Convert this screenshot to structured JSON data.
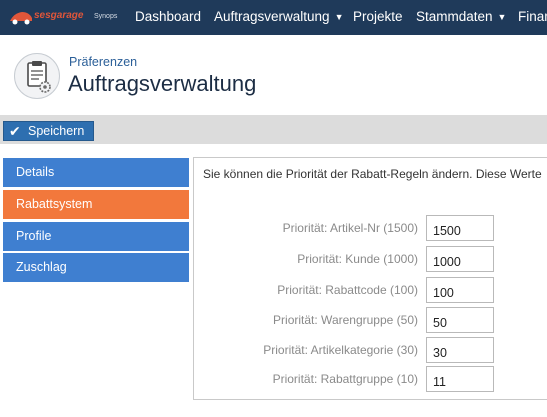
{
  "brand": {
    "logo_text": "sesgarage",
    "sub_text": "Synops"
  },
  "nav": {
    "items": [
      {
        "label": "Dashboard"
      },
      {
        "label": "Auftragsverwaltung"
      },
      {
        "label": "Projekte"
      },
      {
        "label": "Stammdaten"
      },
      {
        "label": "Finan"
      }
    ]
  },
  "header": {
    "breadcrumb": "Präferenzen",
    "title": "Auftragsverwaltung"
  },
  "toolbar": {
    "save_label": "Speichern"
  },
  "sidebar": {
    "items": [
      {
        "label": "Details"
      },
      {
        "label": "Rabattsystem",
        "active": true
      },
      {
        "label": "Profile"
      },
      {
        "label": "Zuschlag"
      }
    ]
  },
  "main": {
    "intro": "Sie können die Priorität der Rabatt-Regeln ändern. Diese Werte",
    "rows": [
      {
        "label": "Priorität: Artikel-Nr (1500)",
        "value": "1500"
      },
      {
        "label": "Priorität: Kunde (1000)",
        "value": "1000"
      },
      {
        "label": "Priorität: Rabattcode (100)",
        "value": "100"
      },
      {
        "label": "Priorität: Warengruppe (50)",
        "value": "50"
      },
      {
        "label": "Priorität: Artikelkategorie (30)",
        "value": "30"
      },
      {
        "label": "Priorität: Rabattgruppe (10)",
        "value": "11"
      }
    ]
  },
  "colors": {
    "nav_bg": "#1f3a5a",
    "accent_blue": "#3f7fd0",
    "active_orange": "#f2783c",
    "save_button": "#2e6fb0"
  }
}
